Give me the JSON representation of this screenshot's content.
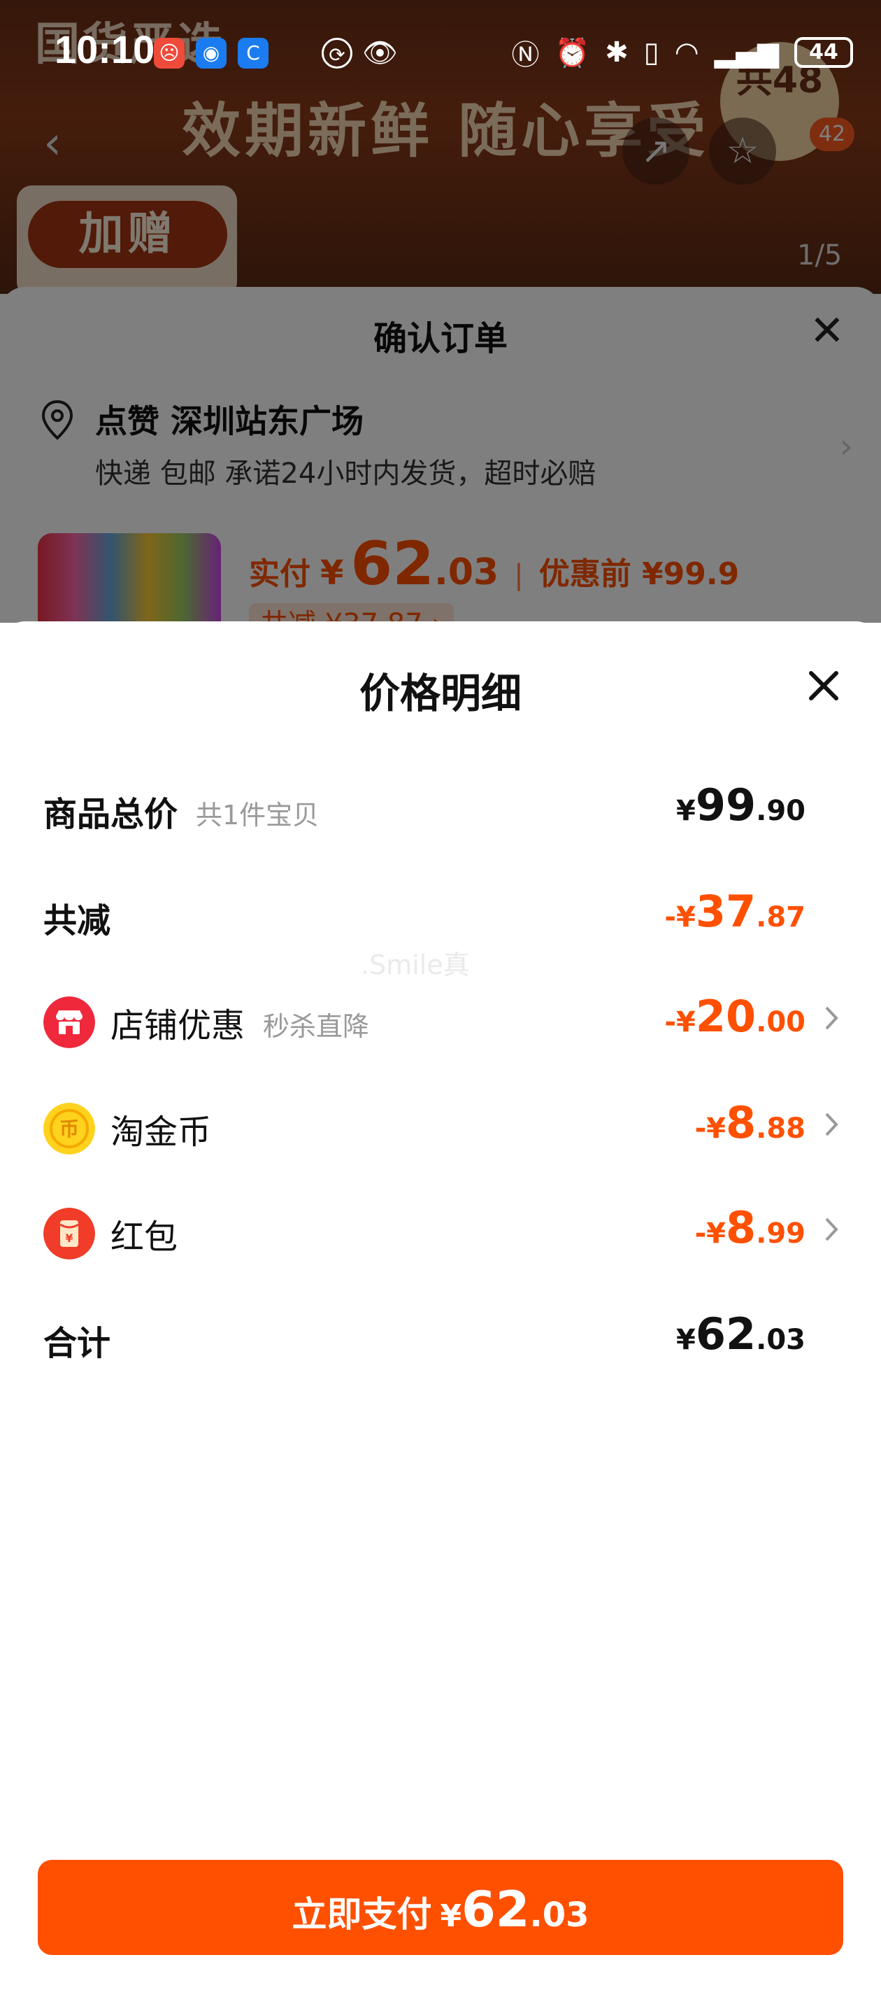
{
  "status_bar": {
    "time": "10:10",
    "battery": "44"
  },
  "background": {
    "brand_text": "国货严选",
    "banner_text": "效期新鲜 随心享受",
    "badge_text": "共48",
    "gift_label": "加赠",
    "cart_count": "42",
    "page_indicator": "1/5"
  },
  "order": {
    "title": "确认订单",
    "address_main": "点赞 深圳站东广场",
    "address_sub": "快递 包邮 承诺24小时内发货，超时必赔",
    "price_label": "实付",
    "currency": "¥",
    "price_int": "62",
    "price_dec": ".03",
    "separator": "|",
    "price_before": "优惠前 ¥99.9",
    "savings": "共减 ¥37.87 ›"
  },
  "detail": {
    "title": "价格明细",
    "watermark": ".Smile真",
    "rows": [
      {
        "label": "商品总价",
        "sublabel": "共1件宝贝",
        "cur": "¥",
        "int": "99",
        "dec": ".90"
      },
      {
        "label": "共减",
        "sublabel": "",
        "cur": "-¥",
        "int": "37",
        "dec": ".87"
      },
      {
        "label": "店铺优惠",
        "sublabel": "秒杀直降",
        "cur": "-¥",
        "int": "20",
        "dec": ".00"
      },
      {
        "label": "淘金币",
        "sublabel": "",
        "cur": "-¥",
        "int": "8",
        "dec": ".88"
      },
      {
        "label": "红包",
        "sublabel": "",
        "cur": "-¥",
        "int": "8",
        "dec": ".99"
      },
      {
        "label": "合计",
        "sublabel": "",
        "cur": "¥",
        "int": "62",
        "dec": ".03"
      }
    ]
  },
  "pay_button": {
    "label": "立即支付",
    "cur": "¥",
    "int": "62",
    "dec": ".03"
  },
  "colors": {
    "accent": "#ff5000",
    "store_icon": "#f0283c",
    "coin_icon": "#ffd21e",
    "redpacket_icon": "#f03c28"
  }
}
